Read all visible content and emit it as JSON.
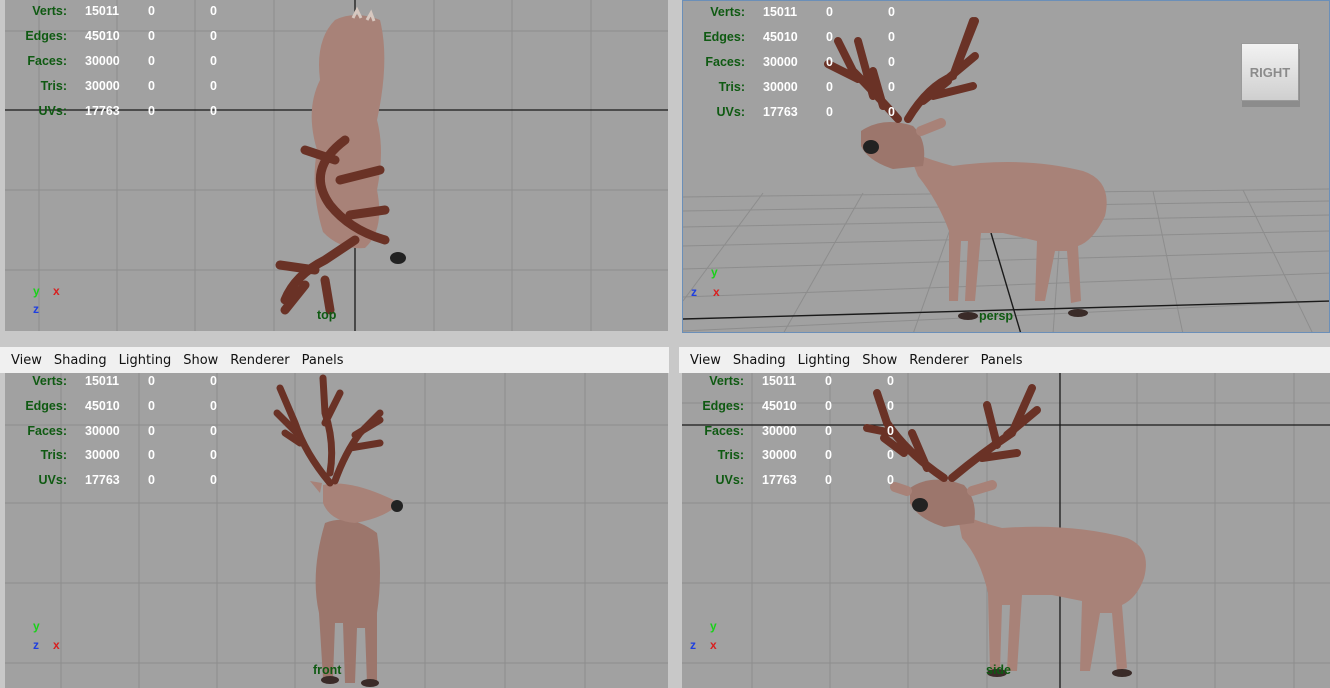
{
  "hud": {
    "labels": [
      "Verts:",
      "Edges:",
      "Faces:",
      "Tris:",
      "UVs:"
    ],
    "rows": [
      {
        "label": "Verts:",
        "v1": "15011",
        "v2": "0",
        "v3": "0"
      },
      {
        "label": "Edges:",
        "v1": "45010",
        "v2": "0",
        "v3": "0"
      },
      {
        "label": "Faces:",
        "v1": "30000",
        "v2": "0",
        "v3": "0"
      },
      {
        "label": "Tris:",
        "v1": "30000",
        "v2": "0",
        "v3": "0"
      },
      {
        "label": "UVs:",
        "v1": "17763",
        "v2": "0",
        "v3": "0"
      }
    ]
  },
  "menu": [
    "View",
    "Shading",
    "Lighting",
    "Show",
    "Renderer",
    "Panels"
  ],
  "viewports": {
    "top": {
      "camera": "top"
    },
    "persp": {
      "camera": "persp",
      "view_cube": "RIGHT"
    },
    "front": {
      "camera": "front"
    },
    "side": {
      "camera": "side"
    }
  },
  "axes": {
    "x": "x",
    "y": "y",
    "z": "z"
  },
  "colors": {
    "viewport_bg": "#a1a1a1",
    "grid_line": "#8d8d8d",
    "axis_line": "#1a1a1a",
    "hud_label": "#0f5a12",
    "hud_value": "#ffffff",
    "deer_body": "#a88278",
    "antler": "#6a3226"
  }
}
